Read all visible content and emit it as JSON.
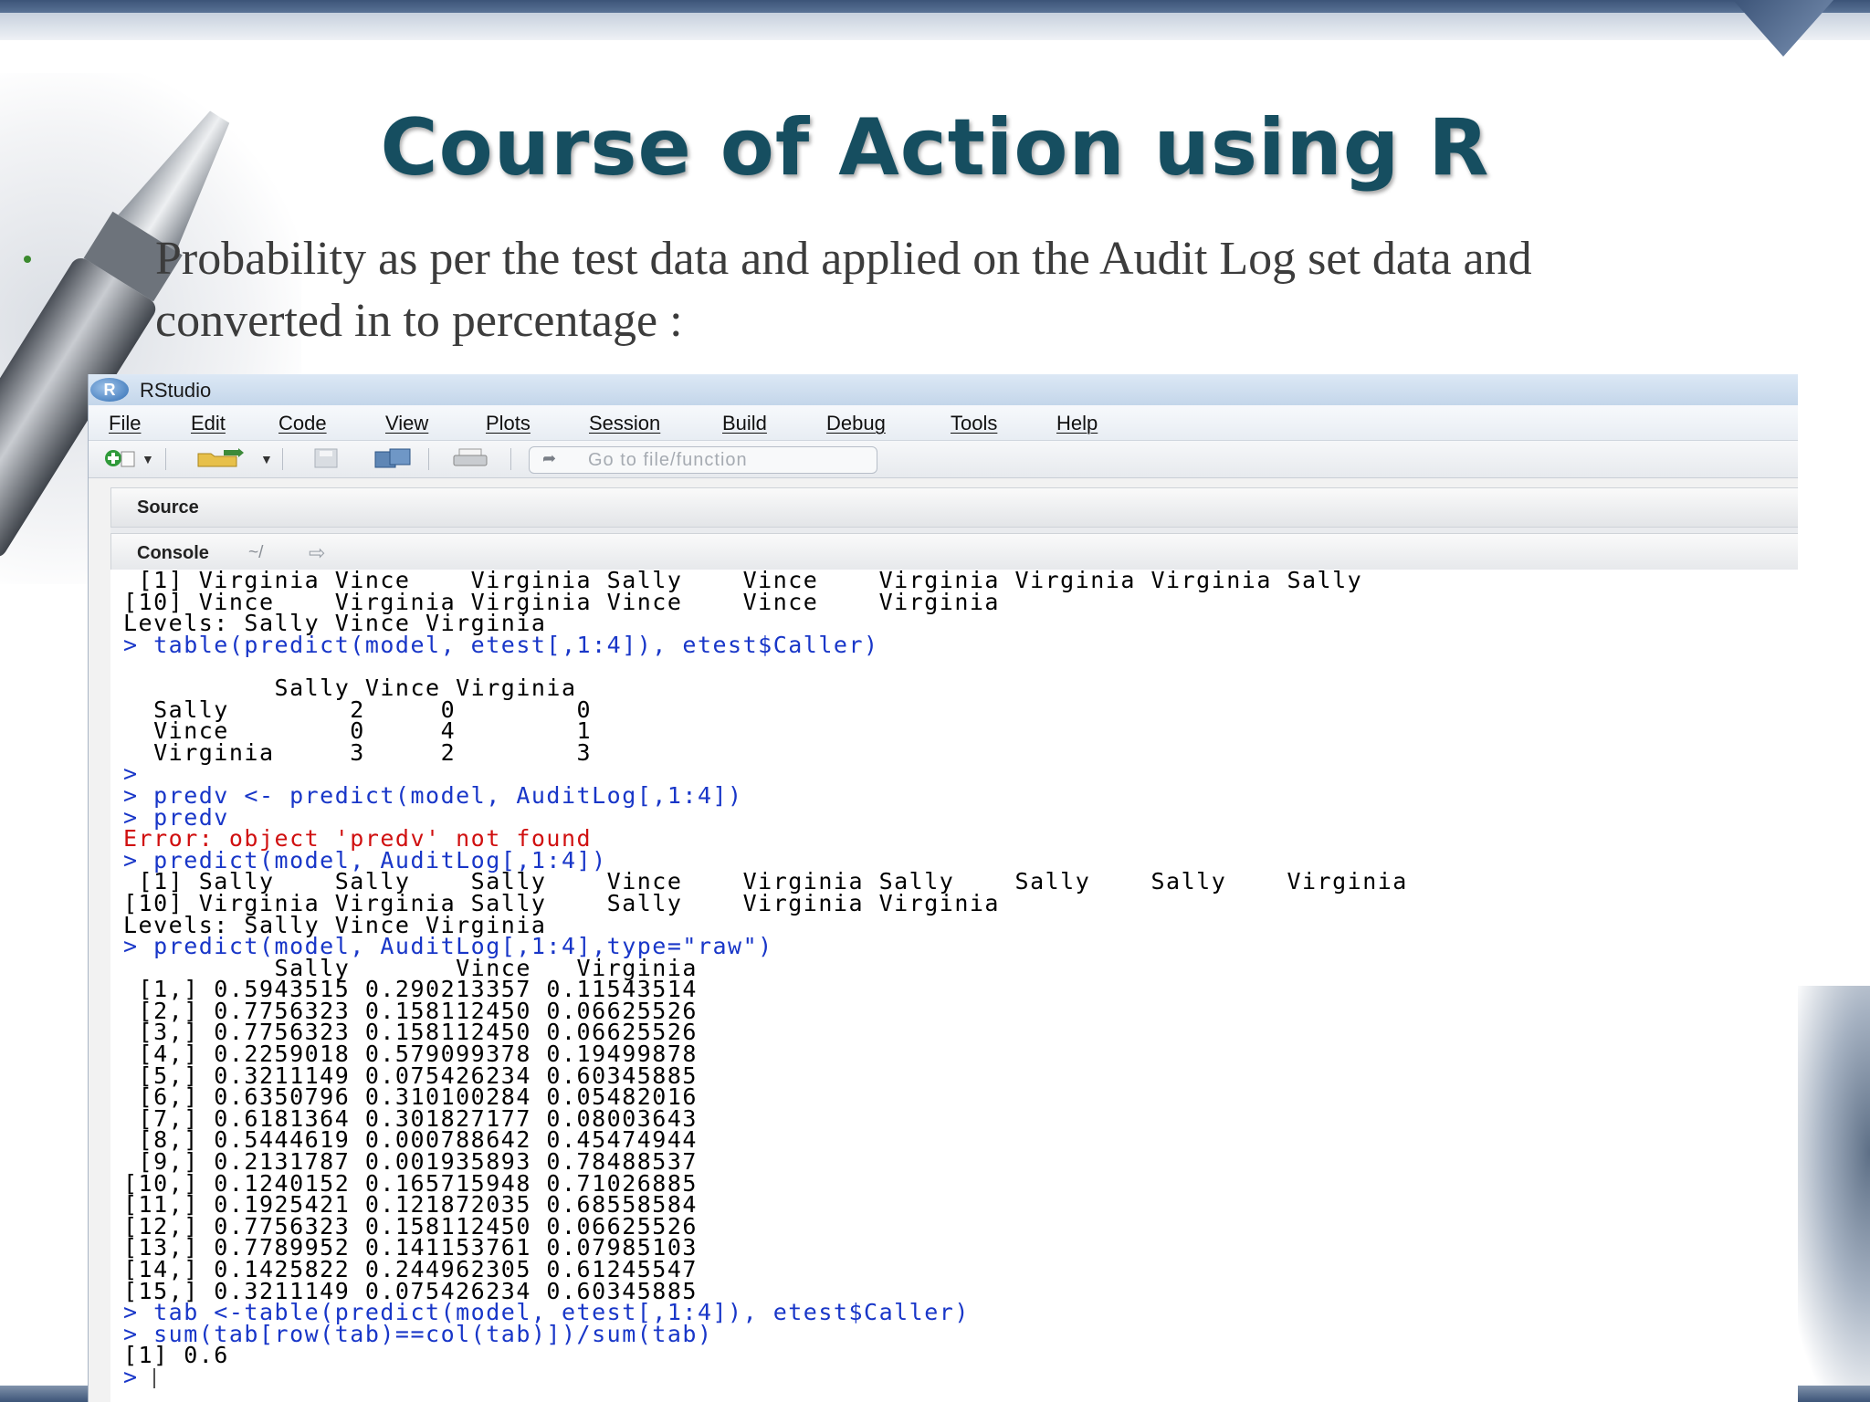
{
  "slide": {
    "title": "Course of Action using R",
    "bullet": "Probability as per the test data and applied on the Audit Log set data and converted in to percentage :"
  },
  "window": {
    "app_title": "RStudio",
    "logo_letter": "R",
    "menu": [
      "File",
      "Edit",
      "Code",
      "View",
      "Plots",
      "Session",
      "Build",
      "Debug",
      "Tools",
      "Help"
    ],
    "goto_placeholder": "Go to file/function",
    "pane_source_label": "Source",
    "pane_console_label": "Console",
    "console_path": "~/"
  },
  "console": {
    "lines": [
      {
        "type": "out",
        "text": " [1] Virginia Vince    Virginia Sally    Vince    Virginia Virginia Virginia Sally"
      },
      {
        "type": "out",
        "text": "[10] Vince    Virginia Virginia Vince    Vince    Virginia"
      },
      {
        "type": "out",
        "text": "Levels: Sally Vince Virginia"
      },
      {
        "type": "cmd",
        "text": "> table(predict(model, etest[,1:4]), etest$Caller)"
      },
      {
        "type": "out",
        "text": ""
      },
      {
        "type": "out",
        "text": "          Sally Vince Virginia"
      },
      {
        "type": "out",
        "text": "  Sally        2     0        0"
      },
      {
        "type": "out",
        "text": "  Vince        0     4        1"
      },
      {
        "type": "out",
        "text": "  Virginia     3     2        3"
      },
      {
        "type": "cmd",
        "text": ">"
      },
      {
        "type": "cmd",
        "text": "> predv <- predict(model, AuditLog[,1:4])"
      },
      {
        "type": "cmd",
        "text": "> predv"
      },
      {
        "type": "err",
        "text": "Error: object 'predv' not found"
      },
      {
        "type": "cmd",
        "text": "> predict(model, AuditLog[,1:4])"
      },
      {
        "type": "out",
        "text": " [1] Sally    Sally    Sally    Vince    Virginia Sally    Sally    Sally    Virginia"
      },
      {
        "type": "out",
        "text": "[10] Virginia Virginia Sally    Sally    Virginia Virginia"
      },
      {
        "type": "out",
        "text": "Levels: Sally Vince Virginia"
      },
      {
        "type": "cmd",
        "text": "> predict(model, AuditLog[,1:4],type=\"raw\")"
      },
      {
        "type": "out",
        "text": "          Sally       Vince   Virginia"
      },
      {
        "type": "out",
        "text": " [1,] 0.5943515 0.290213357 0.11543514"
      },
      {
        "type": "out",
        "text": " [2,] 0.7756323 0.158112450 0.06625526"
      },
      {
        "type": "out",
        "text": " [3,] 0.7756323 0.158112450 0.06625526"
      },
      {
        "type": "out",
        "text": " [4,] 0.2259018 0.579099378 0.19499878"
      },
      {
        "type": "out",
        "text": " [5,] 0.3211149 0.075426234 0.60345885"
      },
      {
        "type": "out",
        "text": " [6,] 0.6350796 0.310100284 0.05482016"
      },
      {
        "type": "out",
        "text": " [7,] 0.6181364 0.301827177 0.08003643"
      },
      {
        "type": "out",
        "text": " [8,] 0.5444619 0.000788642 0.45474944"
      },
      {
        "type": "out",
        "text": " [9,] 0.2131787 0.001935893 0.78488537"
      },
      {
        "type": "out",
        "text": "[10,] 0.1240152 0.165715948 0.71026885"
      },
      {
        "type": "out",
        "text": "[11,] 0.1925421 0.121872035 0.68558584"
      },
      {
        "type": "out",
        "text": "[12,] 0.7756323 0.158112450 0.06625526"
      },
      {
        "type": "out",
        "text": "[13,] 0.7789952 0.141153761 0.07985103"
      },
      {
        "type": "out",
        "text": "[14,] 0.1425822 0.244962305 0.61245547"
      },
      {
        "type": "out",
        "text": "[15,] 0.3211149 0.075426234 0.60345885"
      },
      {
        "type": "cmd",
        "text": "> tab <-table(predict(model, etest[,1:4]), etest$Caller)"
      },
      {
        "type": "cmd",
        "text": "> sum(tab[row(tab)==col(tab)])/sum(tab)"
      },
      {
        "type": "out",
        "text": "[1] 0.6"
      },
      {
        "type": "prompt",
        "text": "> "
      }
    ]
  },
  "colors": {
    "title": "#164e60",
    "command": "#1836c8",
    "error": "#d01010",
    "output": "#000000"
  }
}
